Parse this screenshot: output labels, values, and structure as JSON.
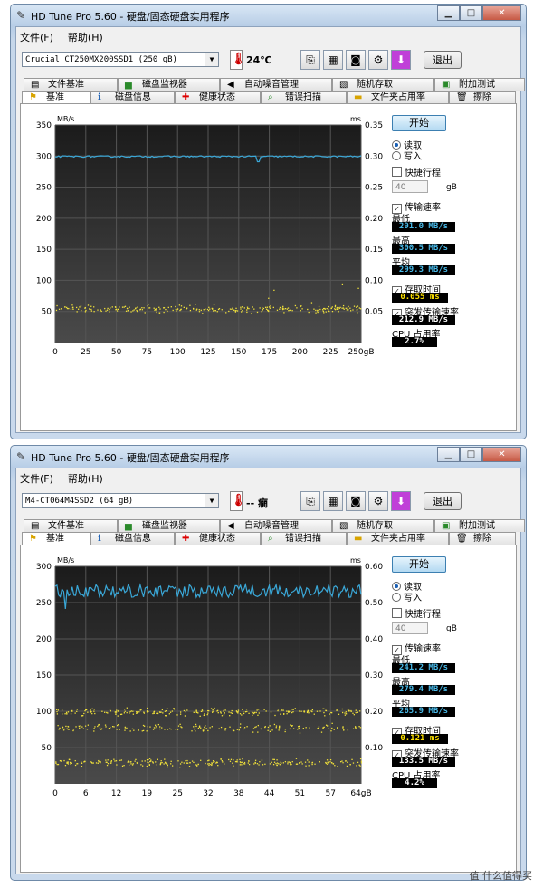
{
  "window": {
    "title": "HD Tune Pro 5.60 - 硬盘/固态硬盘实用程序",
    "menu": [
      "文件(F)",
      "帮助(H)"
    ],
    "exit_label": "退出"
  },
  "tabs_top": [
    "文件基准",
    "磁盘监视器",
    "自动噪音管理",
    "随机存取",
    "附加测试"
  ],
  "tabs_bottom": [
    "基准",
    "磁盘信息",
    "健康状态",
    "错误扫描",
    "文件夹占用率",
    "擦除"
  ],
  "side_labels": {
    "start": "开始",
    "read": "读取",
    "write": "写入",
    "short_stroke": "快捷行程",
    "short_stroke_value": "40",
    "short_stroke_unit": "gB",
    "transfer_rate": "传输速率",
    "min": "最低",
    "max": "最高",
    "avg": "平均",
    "access_time": "存取时间",
    "burst_rate": "突发传输速率",
    "cpu": "CPU 占用率"
  },
  "windows": [
    {
      "drive": "Crucial_CT250MX200SSD1 (250 gB)",
      "temperature": "24℃",
      "results": {
        "min": "291.0 MB/s",
        "max": "300.5 MB/s",
        "avg": "299.3 MB/s",
        "access": "0.055 ms",
        "burst": "212.9 MB/s",
        "cpu": "2.7%"
      },
      "chart_data": {
        "type": "line",
        "y_left_unit": "MB/s",
        "y_right_unit": "ms",
        "y_left_ticks": [
          "350",
          "300",
          "250",
          "200",
          "150",
          "100",
          "50"
        ],
        "y_right_ticks": [
          "0.35",
          "0.30",
          "0.25",
          "0.20",
          "0.15",
          "0.10",
          "0.05"
        ],
        "x_ticks": [
          "0",
          "25",
          "50",
          "75",
          "100",
          "125",
          "150",
          "175",
          "200",
          "225",
          "250gB"
        ],
        "ylim": [
          0,
          350
        ],
        "y2lim": [
          0,
          0.35
        ],
        "xlim": [
          0,
          250
        ],
        "transfer_level": 299.3,
        "transfer_noise": 1.2,
        "dip": {
          "x": 166,
          "y": 291.0
        },
        "access_bands": [
          {
            "center": 0.055,
            "spread": 0.006,
            "density": 1.0
          }
        ],
        "outliers": [
          0.085,
          0.095,
          0.072,
          0.088,
          0.065
        ]
      }
    },
    {
      "drive": "M4-CT064M4SSD2 (64 gB)",
      "temperature": "-- 癎",
      "results": {
        "min": "241.2 MB/s",
        "max": "279.4 MB/s",
        "avg": "265.9 MB/s",
        "access": "0.121 ms",
        "burst": "133.5 MB/s",
        "cpu": "4.2%"
      },
      "chart_data": {
        "type": "line",
        "y_left_unit": "MB/s",
        "y_right_unit": "ms",
        "y_left_ticks": [
          "300",
          "250",
          "200",
          "150",
          "100",
          "50"
        ],
        "y_right_ticks": [
          "0.60",
          "0.50",
          "0.40",
          "0.30",
          "0.20",
          "0.10"
        ],
        "x_ticks": [
          "0",
          "6",
          "12",
          "19",
          "25",
          "32",
          "38",
          "44",
          "51",
          "57",
          "64gB"
        ],
        "ylim": [
          0,
          300
        ],
        "y2lim": [
          0,
          0.6
        ],
        "xlim": [
          0,
          64
        ],
        "transfer_level": 265.9,
        "transfer_noise": 9.0,
        "dip": {
          "x": 2,
          "y": 241.2
        },
        "access_bands": [
          {
            "center": 0.2,
            "spread": 0.01,
            "density": 0.9
          },
          {
            "center": 0.155,
            "spread": 0.01,
            "density": 0.7
          },
          {
            "center": 0.06,
            "spread": 0.01,
            "density": 1.0
          }
        ],
        "outliers": [
          0.21,
          0.19,
          0.16
        ]
      }
    }
  ],
  "watermark": "值 什么值得买"
}
